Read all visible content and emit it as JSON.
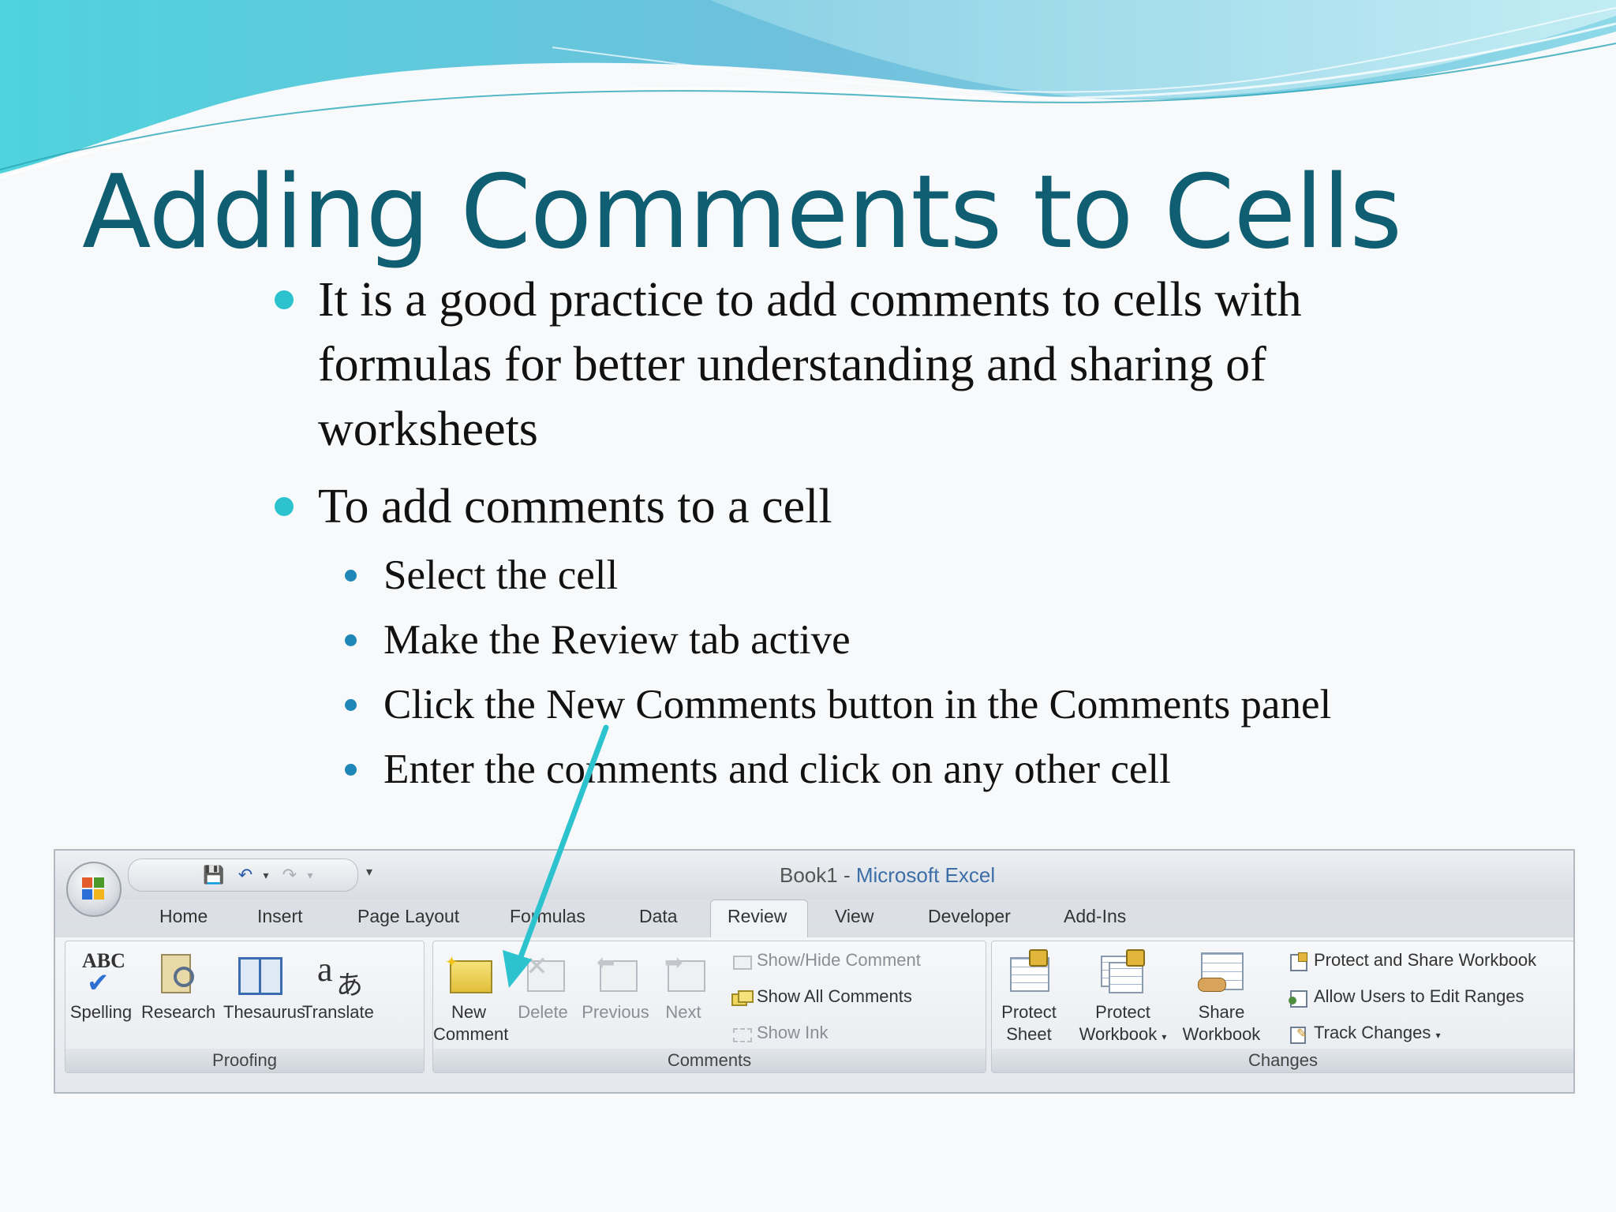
{
  "slide": {
    "title": "Adding Comments to Cells",
    "bullets": [
      "It is a good practice to add comments to cells with formulas for better understanding and sharing of worksheets",
      "To add comments to a cell"
    ],
    "sub_bullets": [
      "Select the cell",
      "Make the Review tab active",
      "Click the New Comments button in the Comments panel",
      "Enter the comments and click on any other cell"
    ]
  },
  "excel": {
    "window_title_doc": "Book1",
    "window_title_sep": " - ",
    "window_title_app": "Microsoft Excel",
    "tabs": [
      "Home",
      "Insert",
      "Page Layout",
      "Formulas",
      "Data",
      "Review",
      "View",
      "Developer",
      "Add-Ins"
    ],
    "active_tab": "Review",
    "groups": {
      "proofing": {
        "label": "Proofing",
        "buttons": [
          "Spelling",
          "Research",
          "Thesaurus",
          "Translate"
        ]
      },
      "comments": {
        "label": "Comments",
        "new_comment_line1": "New",
        "new_comment_line2": "Comment",
        "delete": "Delete",
        "previous": "Previous",
        "next": "Next",
        "show_hide": "Show/Hide Comment",
        "show_all": "Show All Comments",
        "show_ink": "Show Ink"
      },
      "changes": {
        "label": "Changes",
        "protect_sheet_1": "Protect",
        "protect_sheet_2": "Sheet",
        "protect_workbook_1": "Protect",
        "protect_workbook_2": "Workbook",
        "share_workbook_1": "Share",
        "share_workbook_2": "Workbook",
        "protect_share": "Protect and Share Workbook",
        "allow_users": "Allow Users to Edit Ranges",
        "track_changes": "Track Changes"
      }
    },
    "icons": [
      "office-button-icon",
      "save-icon",
      "undo-icon",
      "redo-icon",
      "customize-qat-icon"
    ],
    "accent_arrow_color": "#2cc3cf"
  }
}
